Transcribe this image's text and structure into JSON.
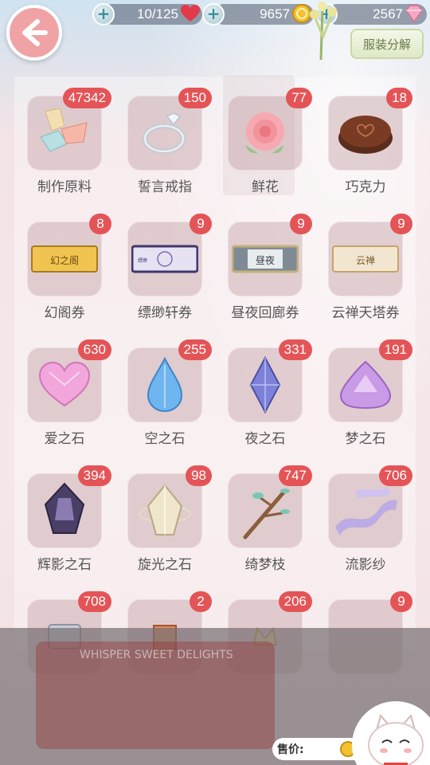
{
  "header": {
    "back_label": "back",
    "stamina": "10/125",
    "gold": "9657",
    "diamonds": "2567",
    "decompose_label": "服装分解"
  },
  "items": [
    {
      "name": "制作原料",
      "count": "47342"
    },
    {
      "name": "誓言戒指",
      "count": "150"
    },
    {
      "name": "鲜花",
      "count": "77"
    },
    {
      "name": "巧克力",
      "count": "18"
    },
    {
      "name": "幻阁券",
      "count": "8"
    },
    {
      "name": "缥缈轩券",
      "count": "9"
    },
    {
      "name": "昼夜回廊券",
      "count": "9"
    },
    {
      "name": "云禅天塔券",
      "count": "9"
    },
    {
      "name": "爱之石",
      "count": "630"
    },
    {
      "name": "空之石",
      "count": "255"
    },
    {
      "name": "夜之石",
      "count": "331"
    },
    {
      "name": "梦之石",
      "count": "191"
    },
    {
      "name": "辉影之石",
      "count": "394"
    },
    {
      "name": "旋光之石",
      "count": "98"
    },
    {
      "name": "绮梦枝",
      "count": "747"
    },
    {
      "name": "流影纱",
      "count": "706"
    },
    {
      "name": "",
      "count": "708"
    },
    {
      "name": "",
      "count": "2"
    },
    {
      "name": "",
      "count": "206"
    },
    {
      "name": "",
      "count": "9"
    }
  ],
  "tickets": {
    "huange": "幻之阁",
    "piaomiao": "缥缈",
    "zhouye": "昼夜",
    "yunchan": "云禅"
  },
  "footer": {
    "price_label": "售价:",
    "bus_sign": "WHISPER SWEET DELIGHTS"
  },
  "colors": {
    "badge": "#e45457",
    "tile": "#c4a0a5",
    "back_button": "#f0a3a5"
  }
}
